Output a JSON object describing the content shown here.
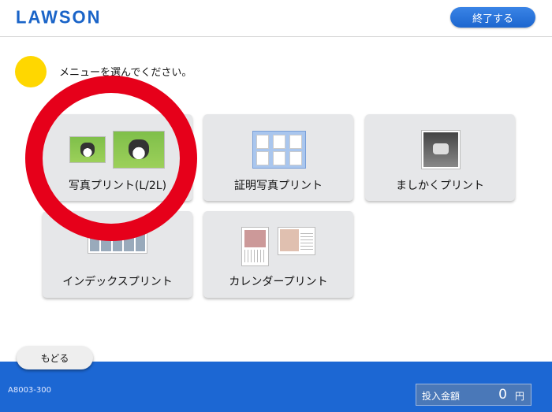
{
  "header": {
    "logo": "LAWSON",
    "end_button": "終了する"
  },
  "instruction": "メニューを選んでください。",
  "menu": [
    {
      "label": "写真プリント(L/2L)"
    },
    {
      "label": "証明写真プリント"
    },
    {
      "label": "ましかくプリント"
    },
    {
      "label": "インデックスプリント"
    },
    {
      "label": "カレンダープリント"
    }
  ],
  "back_button": "もどる",
  "footer": {
    "code": "A8003-300",
    "amount_label": "投入金額",
    "amount_value": "0",
    "amount_unit": "円"
  },
  "colors": {
    "brand_blue": "#1a64c8",
    "footer_blue": "#1c67d3",
    "highlight_red": "#e6001a",
    "marker_yellow": "#ffd700"
  }
}
